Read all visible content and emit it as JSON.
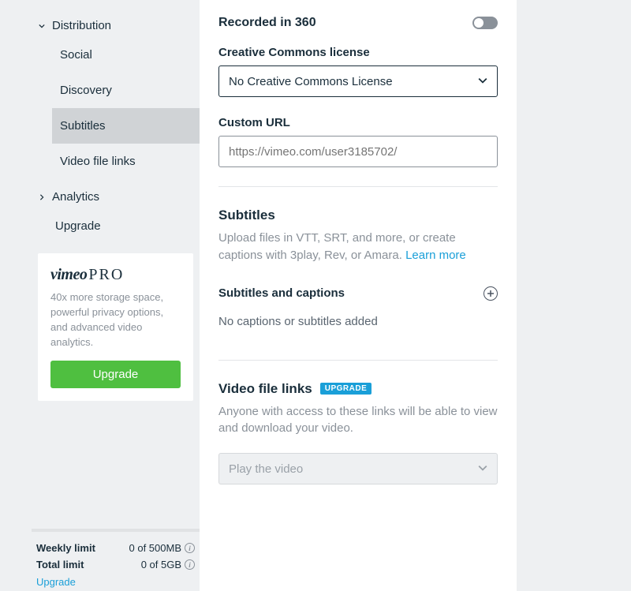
{
  "sidebar": {
    "distribution": {
      "label": "Distribution",
      "items": [
        "Social",
        "Discovery",
        "Subtitles",
        "Video file links"
      ],
      "active_index": 2
    },
    "analytics": {
      "label": "Analytics"
    },
    "upgrade_nav": "Upgrade",
    "promo": {
      "logo_main": "vimeo",
      "logo_sub": "PRO",
      "desc": "40x more storage space, powerful privacy options, and advanced video analytics.",
      "button": "Upgrade"
    },
    "footer": {
      "weekly_label": "Weekly limit",
      "weekly_value": "0 of 500MB",
      "total_label": "Total limit",
      "total_value": "0 of 5GB",
      "upgrade": "Upgrade"
    }
  },
  "main": {
    "recorded360": {
      "label": "Recorded in 360"
    },
    "cc": {
      "label": "Creative Commons license",
      "value": "No Creative Commons License"
    },
    "custom_url": {
      "label": "Custom URL",
      "placeholder": "https://vimeo.com/user3185702/"
    },
    "subtitles": {
      "title": "Subtitles",
      "desc": "Upload files in VTT, SRT, and more, or create captions with 3play, Rev, or Amara. ",
      "learn": "Learn more",
      "sub_label": "Subtitles and captions",
      "empty": "No captions or subtitles added"
    },
    "vfl": {
      "title": "Video file links",
      "badge": "UPGRADE",
      "desc": "Anyone with access to these links will be able to view and download your video.",
      "select_value": "Play the video"
    }
  }
}
